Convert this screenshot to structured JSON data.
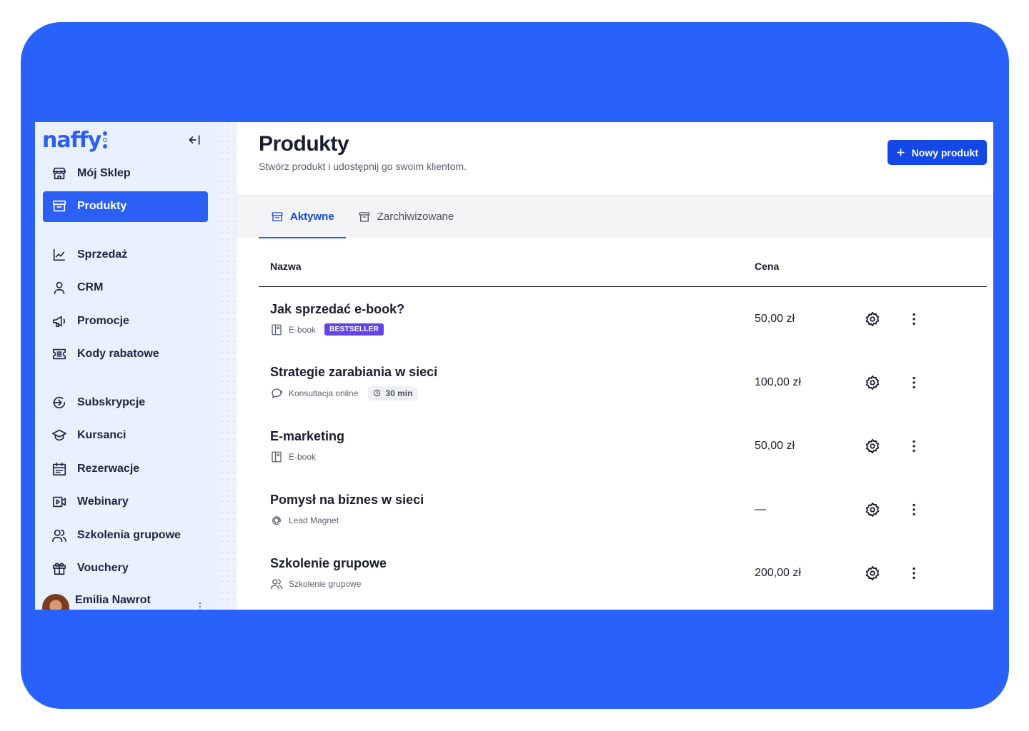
{
  "brand": {
    "logo_text": "naffy",
    "accent": "#2b5ff5",
    "frame_color": "#2962fb"
  },
  "sidebar": {
    "collapse_icon": "collapse-left-icon",
    "groups": [
      [
        {
          "label": "Mój Sklep",
          "icon": "store-icon",
          "active": false
        },
        {
          "label": "Produkty",
          "icon": "archive-box-icon",
          "active": true
        }
      ],
      [
        {
          "label": "Sprzedaż",
          "icon": "chart-line-icon",
          "active": false
        },
        {
          "label": "CRM",
          "icon": "user-icon",
          "active": false
        },
        {
          "label": "Promocje",
          "icon": "megaphone-icon",
          "active": false
        },
        {
          "label": "Kody rabatowe",
          "icon": "ticket-icon",
          "active": false
        }
      ],
      [
        {
          "label": "Subskrypcje",
          "icon": "subscription-icon",
          "active": false
        },
        {
          "label": "Kursanci",
          "icon": "graduation-cap-icon",
          "active": false
        },
        {
          "label": "Rezerwacje",
          "icon": "calendar-icon",
          "active": false
        },
        {
          "label": "Webinary",
          "icon": "video-icon",
          "active": false
        },
        {
          "label": "Szkolenia grupowe",
          "icon": "users-icon",
          "active": false
        },
        {
          "label": "Vouchery",
          "icon": "gift-icon",
          "active": false
        }
      ]
    ],
    "user": {
      "name": "Emilia Nawrot",
      "menu": "⋮"
    }
  },
  "header": {
    "title": "Produkty",
    "subtitle": "Stwórz produkt i udostępnij go swoim klientom.",
    "new_button": "Nowy produkt"
  },
  "tabs": [
    {
      "label": "Aktywne",
      "icon": "archive-box-icon",
      "active": true
    },
    {
      "label": "Zarchiwizowane",
      "icon": "archive-icon",
      "active": false
    }
  ],
  "table": {
    "columns": {
      "name": "Nazwa",
      "price": "Cena"
    },
    "rows": [
      {
        "name": "Jak sprzedać e-book?",
        "type": "E-book",
        "type_icon": "book-icon",
        "badge": "BESTSELLER",
        "chip": "",
        "price": "50,00 zł"
      },
      {
        "name": "Strategie zarabiania w sieci",
        "type": "Konsultacja online",
        "type_icon": "chat-bubble-icon",
        "badge": "",
        "chip": "30 min",
        "price": "100,00 zł"
      },
      {
        "name": "E-marketing",
        "type": "E-book",
        "type_icon": "book-icon",
        "badge": "",
        "chip": "",
        "price": "50,00 zł"
      },
      {
        "name": "Pomysł na biznes w sieci",
        "type": "Lead Magnet",
        "type_icon": "at-sign-icon",
        "badge": "",
        "chip": "",
        "price": "—"
      },
      {
        "name": "Szkolenie grupowe",
        "type": "Szkolenie grupowe",
        "type_icon": "users-icon",
        "badge": "",
        "chip": "",
        "price": "200,00 zł"
      }
    ]
  }
}
